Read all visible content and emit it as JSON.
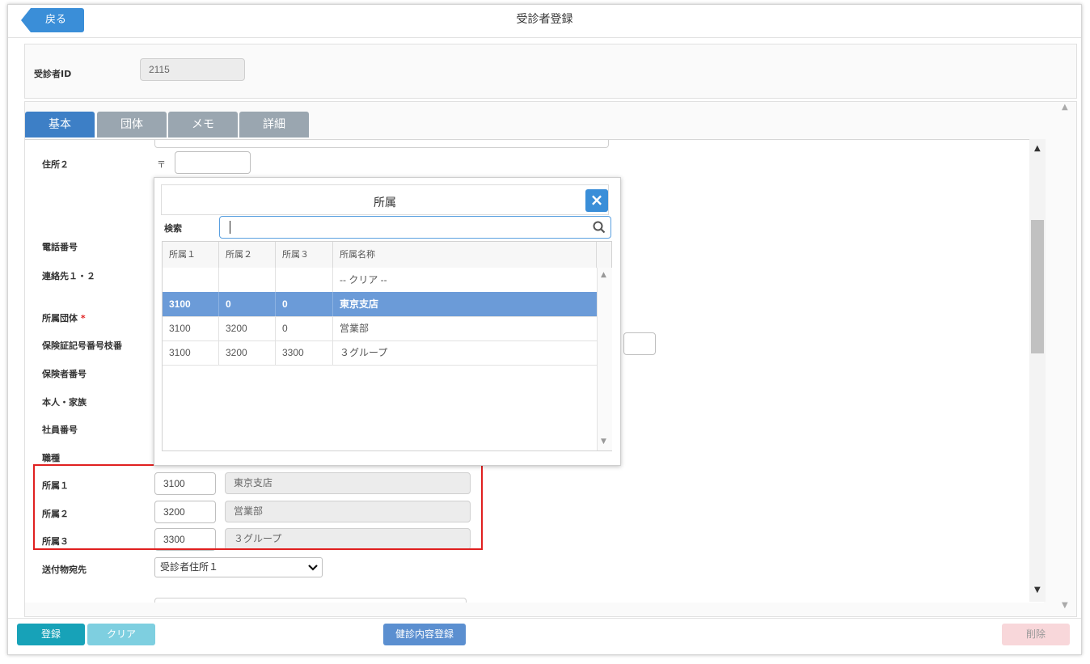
{
  "header": {
    "back_label": "戻る",
    "title": "受診者登録"
  },
  "id_section": {
    "label": "受診者ID",
    "value": "2115"
  },
  "tabs": [
    {
      "label": "基本"
    },
    {
      "label": "団体"
    },
    {
      "label": "メモ"
    },
    {
      "label": "詳細"
    }
  ],
  "form": {
    "address2_label": "住所２",
    "postal_mark": "〒",
    "phone_label": "電話番号",
    "contact_label": "連絡先１・２",
    "group_label": "所属団体",
    "required_mark": "*",
    "insurance_card_label": "保険証記号番号枝番",
    "insurer_label": "保険者番号",
    "family_label": "本人・家族",
    "employee_label": "社員番号",
    "job_label": "職種",
    "affil1": {
      "label": "所属１",
      "code": "3100",
      "name": "東京支店"
    },
    "affil2": {
      "label": "所属２",
      "code": "3200",
      "name": "営業部"
    },
    "affil3": {
      "label": "所属３",
      "code": "3300",
      "name": "３グループ"
    },
    "send_label": "送付物宛先",
    "send_value": "受診者住所１"
  },
  "popup": {
    "title": "所属",
    "search_label": "検索",
    "search_value": "",
    "columns": [
      "所属１",
      "所属２",
      "所属３",
      "所属名称"
    ],
    "rows": [
      {
        "c1": "",
        "c2": "",
        "c3": "",
        "name": "-- クリア --"
      },
      {
        "c1": "3100",
        "c2": "0",
        "c3": "0",
        "name": "東京支店"
      },
      {
        "c1": "3100",
        "c2": "3200",
        "c3": "0",
        "name": "営業部"
      },
      {
        "c1": "3100",
        "c2": "3200",
        "c3": "3300",
        "name": "３グループ"
      }
    ]
  },
  "footer": {
    "register": "登録",
    "clear": "クリア",
    "health_register": "健診内容登録",
    "delete": "削除"
  },
  "colors": {
    "primary": "#3a8ed8",
    "tab_active": "#3d7fc6",
    "selected_row": "#6b9bd8",
    "register": "#17a2b8",
    "delete": "#f8d7da",
    "highlight": "#e02020"
  }
}
